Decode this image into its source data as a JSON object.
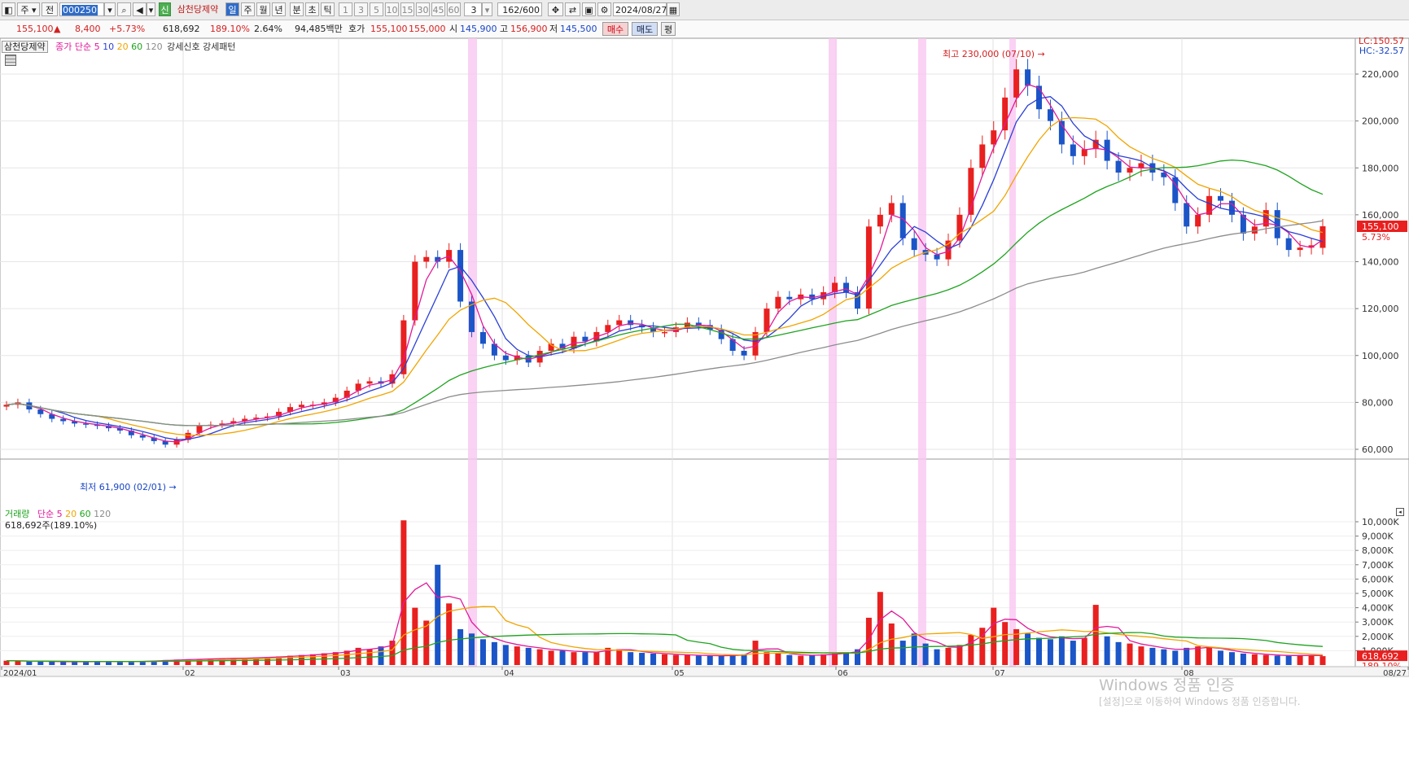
{
  "toolbar": {
    "type_label": "주",
    "view_label": "전",
    "code_value": "000250",
    "new_badge": "신",
    "stock_name": "삼천당제약",
    "periods": [
      "일",
      "주",
      "월",
      "년",
      "분",
      "초",
      "틱"
    ],
    "minutes": [
      "1",
      "3",
      "5",
      "10",
      "15",
      "30",
      "45",
      "60"
    ],
    "unit_value": "3",
    "count_value": "162",
    "count_total": "/600",
    "date_value": "2024/08/27",
    "icons": [
      "toolbar-layout-icon",
      "search-icon",
      "speaker-icon",
      "crosshair-icon",
      "compare-icon",
      "save-icon",
      "settings-icon",
      "calendar-icon"
    ]
  },
  "infobar": {
    "price": "155,100",
    "change_arrow": "▲",
    "change": "8,400",
    "change_pct": "+5.73%",
    "volume": "618,692",
    "volume_ratio": "189.10%",
    "turnover": "2.64%",
    "amount": "94,485백만",
    "ask_label": "호가",
    "ask_price": "155,100",
    "bid_price": "155,000",
    "open_label": "시",
    "open": "145,900",
    "high_label": "고",
    "high": "156,900",
    "low_label": "저",
    "low": "145,500",
    "buy_label": "매수",
    "sell_label": "매도",
    "eval_label": "평"
  },
  "price_panel": {
    "title": "삼천당제약",
    "ma_label": "종가 단순",
    "ma_periods": [
      "5",
      "10",
      "20",
      "60",
      "120"
    ],
    "signal_label": "강세신호 강세패턴",
    "lc_label": "LC:150.57",
    "hc_label": "HC:-32.57",
    "high_annotation": "최고 230,000 (07/10)",
    "low_annotation": "최저 61,900 (02/01)",
    "last_price_tag": "155,100",
    "last_pct_tag": "5.73%",
    "y_ticks": [
      "220,000",
      "200,000",
      "180,000",
      "160,000",
      "140,000",
      "120,000",
      "100,000",
      "80,000",
      "60,000"
    ]
  },
  "volume_panel": {
    "title": "거래량",
    "ma_label": "단순",
    "ma_periods": [
      "5",
      "20",
      "60",
      "120"
    ],
    "current_label": "618,692주(189.10%)",
    "y_ticks": [
      "10,000K",
      "9,000K",
      "8,000K",
      "7,000K",
      "6,000K",
      "5,000K",
      "4,000K",
      "3,000K",
      "2,000K",
      "1,000K"
    ],
    "last_volume_tag": "618,692",
    "last_ratio_tag": "189.10%"
  },
  "x_ticks": [
    "2024/01",
    "02",
    "03",
    "04",
    "05",
    "06",
    "07",
    "08",
    "08/27"
  ],
  "watermark": "Windows 정품 인증",
  "watermark_sub": "[설정]으로 이동하여 Windows 정품 인증합니다.",
  "colors": {
    "up": "#e8201f",
    "down": "#1b55c7",
    "ma5": "#e0199a",
    "ma10": "#2a3fd6",
    "ma20": "#f0a500",
    "ma60": "#1fa31f",
    "ma120": "#8c8c8c",
    "signal": "#f9c7f1"
  },
  "chart_data": {
    "type": "candlestick",
    "x_range": [
      "2024/01",
      "08/27"
    ],
    "ylim": [
      60000,
      230000
    ],
    "volume_ylim": [
      0,
      10000000
    ],
    "signal_months_near": [
      "03 end",
      "05 end",
      "06 mid",
      "07 start"
    ],
    "key_points": [
      {
        "label": "최저",
        "value": 61900,
        "date": "02/01"
      },
      {
        "label": "최고",
        "value": 230000,
        "date": "07/10"
      },
      {
        "label": "종가",
        "value": 155100,
        "date": "08/27"
      }
    ],
    "close_path": [
      79000,
      80000,
      77000,
      75000,
      73000,
      72000,
      71000,
      70500,
      70000,
      69000,
      68000,
      66000,
      65000,
      63500,
      62000,
      64000,
      67000,
      70000,
      70500,
      71000,
      72000,
      73000,
      73500,
      74000,
      76000,
      78000,
      79000,
      79000,
      80000,
      82000,
      85000,
      88000,
      89000,
      88000,
      92000,
      115000,
      140000,
      142000,
      140000,
      145000,
      123000,
      110000,
      105000,
      100000,
      98000,
      100000,
      97000,
      102000,
      105000,
      103000,
      108000,
      106000,
      110000,
      113000,
      115000,
      113000,
      112000,
      110000,
      110000,
      112000,
      114000,
      113000,
      111000,
      107000,
      102000,
      100000,
      110000,
      120000,
      125000,
      124000,
      126000,
      124000,
      127000,
      131000,
      127000,
      120000,
      155000,
      160000,
      165000,
      150000,
      145000,
      143000,
      141000,
      149000,
      160000,
      180000,
      190000,
      196000,
      210000,
      222000,
      215000,
      205000,
      200000,
      190000,
      185000,
      188000,
      192000,
      183000,
      178000,
      180000,
      182000,
      178000,
      176000,
      165000,
      155000,
      160000,
      168000,
      166000,
      160000,
      152000,
      155000,
      162000,
      150000,
      145000,
      146000,
      147000,
      155100
    ],
    "volume_k": [
      300,
      280,
      260,
      250,
      240,
      230,
      220,
      230,
      250,
      240,
      230,
      260,
      280,
      300,
      350,
      380,
      400,
      420,
      450,
      460,
      480,
      500,
      520,
      560,
      600,
      650,
      700,
      750,
      820,
      900,
      1000,
      1200,
      1100,
      1300,
      1700,
      10100,
      4000,
      3100,
      7000,
      4300,
      2500,
      2200,
      1800,
      1600,
      1400,
      1300,
      1200,
      1100,
      1000,
      1000,
      900,
      900,
      900,
      1200,
      1100,
      900,
      850,
      800,
      750,
      700,
      700,
      650,
      650,
      650,
      700,
      750,
      1700,
      900,
      800,
      700,
      650,
      700,
      750,
      800,
      900,
      1100,
      3300,
      5100,
      2900,
      1700,
      2200,
      1500,
      1100,
      1200,
      1400,
      2100,
      2600,
      4000,
      3000,
      2500,
      2200,
      1900,
      1800,
      2000,
      1700,
      1900,
      4200,
      2000,
      1600,
      1500,
      1300,
      1200,
      1100,
      1000,
      1200,
      1300,
      1200,
      1000,
      900,
      800,
      750,
      700,
      650,
      650,
      700,
      650,
      619
    ]
  }
}
